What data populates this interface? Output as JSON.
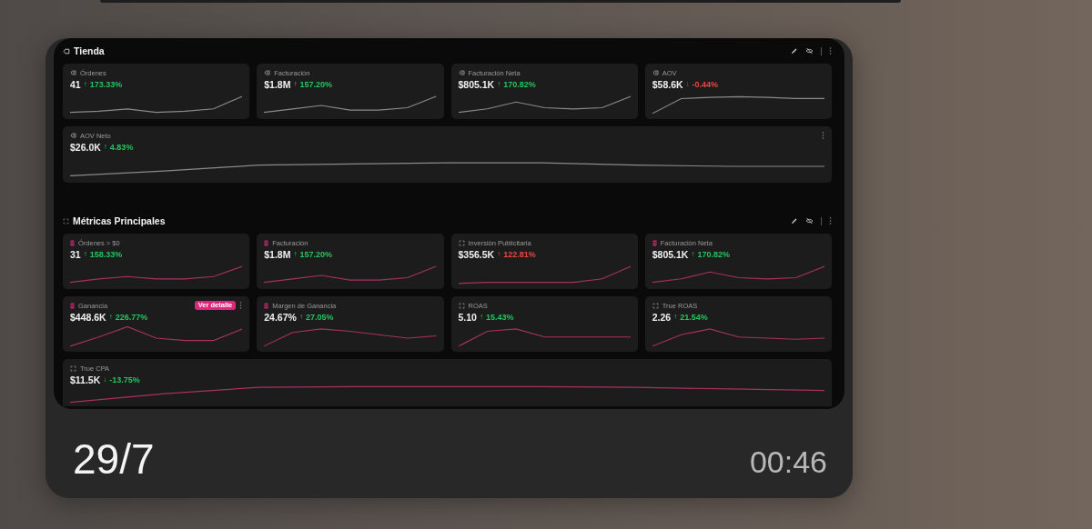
{
  "sections": [
    {
      "title": "Tienda",
      "kind": "store",
      "cards": [
        {
          "kind": "tag",
          "label": "Órdenes",
          "value": "41",
          "arrow": "↑",
          "change": "173.33%",
          "color": "#22c55e",
          "wide": false
        },
        {
          "kind": "tag",
          "label": "Facturación",
          "value": "$1.8M",
          "arrow": "↑",
          "change": "157.20%",
          "color": "#22c55e",
          "wide": false
        },
        {
          "kind": "tag",
          "label": "Facturación Neta",
          "value": "$805.1K",
          "arrow": "↑",
          "change": "170.82%",
          "color": "#22c55e",
          "wide": false
        },
        {
          "kind": "tag",
          "label": "AOV",
          "value": "$58.6K",
          "arrow": "↓",
          "change": "-0.44%",
          "color": "#ef4444",
          "wide": false
        },
        {
          "kind": "tag",
          "label": "AOV Neto",
          "value": "$26.0K",
          "arrow": "↑",
          "change": "4.83%",
          "color": "#22c55e",
          "wide": true,
          "menu": true
        }
      ]
    },
    {
      "title": "Métricas Principales",
      "kind": "metrics",
      "cards": [
        {
          "kind": "bar",
          "label": "Órdenes > $0",
          "value": "31",
          "arrow": "↑",
          "change": "158.33%",
          "color": "#22c55e",
          "wide": false
        },
        {
          "kind": "bar",
          "label": "Facturación",
          "value": "$1.8M",
          "arrow": "↑",
          "change": "157.20%",
          "color": "#22c55e",
          "wide": false
        },
        {
          "kind": "frame",
          "label": "Inversión Publicitaria",
          "value": "$356.5K",
          "arrow": "↑",
          "change": "122.81%",
          "color": "#ef4444",
          "wide": false
        },
        {
          "kind": "bar",
          "label": "Facturación Neta",
          "value": "$805.1K",
          "arrow": "↑",
          "change": "170.82%",
          "color": "#22c55e",
          "wide": false
        },
        {
          "kind": "bar",
          "label": "Ganancia",
          "value": "$448.6K",
          "arrow": "↑",
          "change": "226.77%",
          "color": "#22c55e",
          "wide": false,
          "badge": "Ver detalle",
          "menu": true
        },
        {
          "kind": "bar",
          "label": "Margen de Ganancia",
          "value": "24.67%",
          "arrow": "↑",
          "change": "27.05%",
          "color": "#22c55e",
          "wide": false
        },
        {
          "kind": "frame",
          "label": "ROAS",
          "value": "5.10",
          "arrow": "↑",
          "change": "15.43%",
          "color": "#22c55e",
          "wide": false
        },
        {
          "kind": "frame",
          "label": "True ROAS",
          "value": "2.26",
          "arrow": "↑",
          "change": "21.54%",
          "color": "#22c55e",
          "wide": false
        },
        {
          "kind": "frame",
          "label": "True CPA",
          "value": "$11.5K",
          "arrow": "↓",
          "change": "-13.75%",
          "color": "#22c55e",
          "wide": true
        }
      ]
    }
  ],
  "date": "29/7",
  "duration": "00:46"
}
